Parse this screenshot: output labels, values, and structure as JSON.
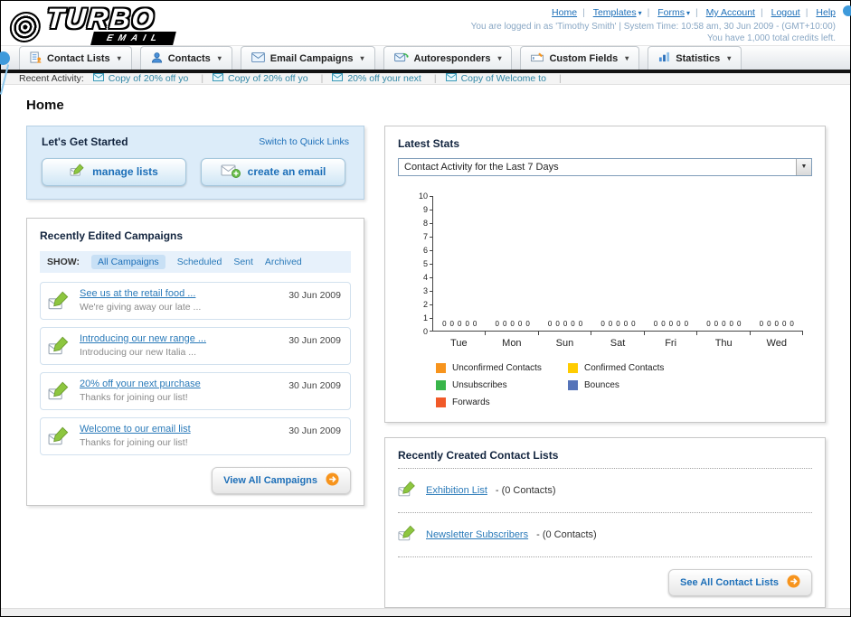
{
  "header": {
    "logo_line1": "TURBO",
    "logo_line2": "EMAIL",
    "links": {
      "home": "Home",
      "templates": "Templates",
      "forms": "Forms",
      "my_account": "My Account",
      "logout": "Logout",
      "help": "Help"
    },
    "session_line": "You are logged in as 'Timothy Smith' | System Time: 10:58 am, 30 Jun 2009 - (GMT+10:00)",
    "credits_line": "You have 1,000 total credits left."
  },
  "nav_tabs": {
    "contact_lists": "Contact Lists",
    "contacts": "Contacts",
    "email_campaigns": "Email Campaigns",
    "autoresponders": "Autoresponders",
    "custom_fields": "Custom Fields",
    "statistics": "Statistics"
  },
  "recent_activity": {
    "label": "Recent Activity:",
    "items": [
      {
        "text": "Copy of 20% off yo"
      },
      {
        "text": "Copy of 20% off yo"
      },
      {
        "text": "20% off your next"
      },
      {
        "text": "Copy of Welcome to"
      }
    ]
  },
  "page_title": "Home",
  "get_started": {
    "title": "Let's Get Started",
    "switch_link": "Switch to Quick Links",
    "manage_lists_button": "manage lists",
    "create_email_button": "create an email"
  },
  "campaigns_panel": {
    "title": "Recently Edited Campaigns",
    "show_label": "SHOW:",
    "filters": [
      "All Campaigns",
      "Scheduled",
      "Sent",
      "Archived"
    ],
    "rows": [
      {
        "title": "See us at the retail food ...",
        "subtitle": "We're giving away our late ...",
        "date": "30 Jun 2009"
      },
      {
        "title": "Introducing our new range ...",
        "subtitle": "Introducing our new Italia ...",
        "date": "30 Jun 2009"
      },
      {
        "title": "20% off your next purchase",
        "subtitle": "Thanks for joining our list!",
        "date": "30 Jun 2009"
      },
      {
        "title": "Welcome to our email list",
        "subtitle": "Thanks for joining our list!",
        "date": "30 Jun 2009"
      }
    ],
    "view_all_button": "View All Campaigns"
  },
  "stats_panel": {
    "title": "Latest Stats",
    "dropdown_value": "Contact Activity for the Last 7 Days"
  },
  "chart_data": {
    "type": "bar",
    "title": "Contact Activity for the Last 7 Days",
    "categories": [
      "Tue",
      "Mon",
      "Sun",
      "Sat",
      "Fri",
      "Thu",
      "Wed"
    ],
    "series": [
      {
        "name": "Unconfirmed Contacts",
        "color": "#f7941d",
        "values": [
          0,
          0,
          0,
          0,
          0,
          0,
          0
        ]
      },
      {
        "name": "Confirmed Contacts",
        "color": "#ffcc00",
        "values": [
          0,
          0,
          0,
          0,
          0,
          0,
          0
        ]
      },
      {
        "name": "Unsubscribes",
        "color": "#39b54a",
        "values": [
          0,
          0,
          0,
          0,
          0,
          0,
          0
        ]
      },
      {
        "name": "Bounces",
        "color": "#5674b9",
        "values": [
          0,
          0,
          0,
          0,
          0,
          0,
          0
        ]
      },
      {
        "name": "Forwards",
        "color": "#f15a29",
        "values": [
          0,
          0,
          0,
          0,
          0,
          0,
          0
        ]
      }
    ],
    "ylim": [
      0,
      10
    ],
    "grid": false,
    "legend_position": "bottom"
  },
  "contact_lists_panel": {
    "title": "Recently Created Contact Lists",
    "items": [
      {
        "name": "Exhibition List",
        "suffix": "- (0 Contacts)"
      },
      {
        "name": "Newsletter Subscribers",
        "suffix": "- (0 Contacts)"
      }
    ],
    "see_all_button": "See All Contact Lists"
  }
}
